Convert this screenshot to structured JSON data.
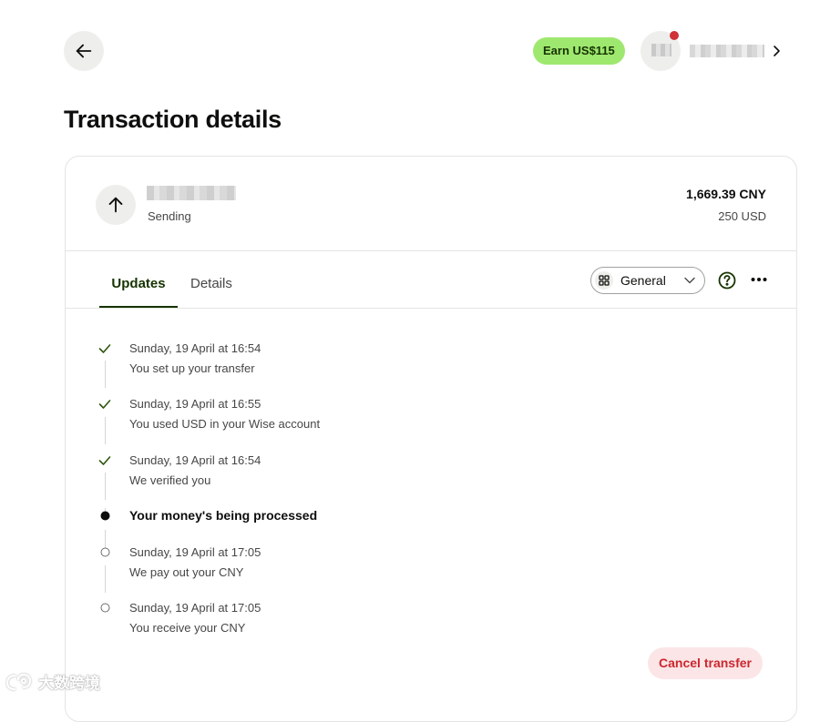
{
  "header": {
    "earn_badge": "Earn US$115",
    "icons": {
      "back": "arrow-left-icon",
      "profile_chevron": "chevron-right-icon"
    }
  },
  "page": {
    "title": "Transaction details"
  },
  "summary": {
    "status": "Sending",
    "amount_primary": "1,669.39 CNY",
    "amount_secondary": "250 USD",
    "icon": "arrow-up-icon"
  },
  "tabs": [
    {
      "label": "Updates",
      "active": true
    },
    {
      "label": "Details",
      "active": false
    }
  ],
  "view_select": {
    "value": "General",
    "icon": "grid-icon"
  },
  "timeline": [
    {
      "state": "done",
      "date": "Sunday, 19 April at 16:54",
      "description": "You set up your transfer"
    },
    {
      "state": "done",
      "date": "Sunday, 19 April at 16:55",
      "description": "You used USD in your Wise account"
    },
    {
      "state": "done",
      "date": "Sunday, 19 April at 16:54",
      "description": "We verified you"
    },
    {
      "state": "current",
      "title": "Your money's being processed"
    },
    {
      "state": "pending",
      "date": "Sunday, 19 April at 17:05",
      "description": "We pay out your CNY"
    },
    {
      "state": "pending",
      "date": "Sunday, 19 April at 17:05",
      "description": "You receive your CNY"
    }
  ],
  "actions": {
    "cancel_label": "Cancel transfer"
  },
  "watermark": {
    "text": "大数跨境"
  },
  "colors": {
    "accent_green": "#9fe870",
    "forest": "#163300",
    "danger": "#cb272f",
    "danger_bg": "#fbe5e6",
    "notification": "#d03238"
  }
}
